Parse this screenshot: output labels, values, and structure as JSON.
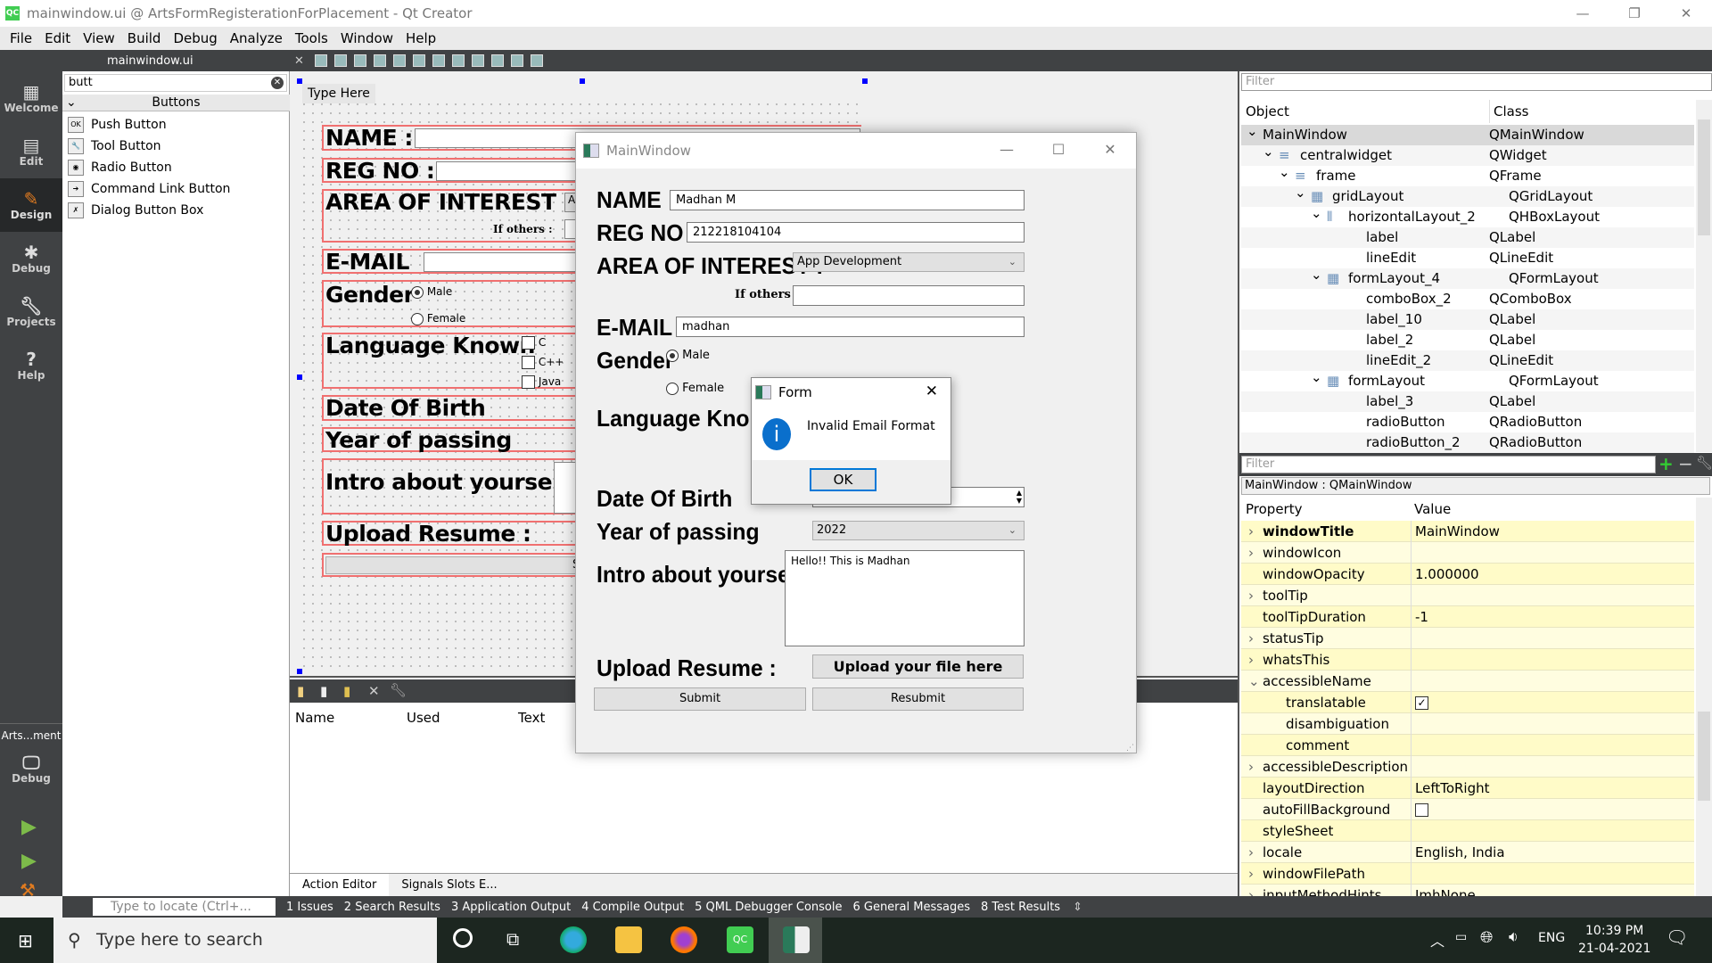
{
  "window": {
    "title": "mainwindow.ui @ ArtsFormRegisterationForPlacement - Qt Creator",
    "app_icon": "QC"
  },
  "menu": [
    "File",
    "Edit",
    "View",
    "Build",
    "Debug",
    "Analyze",
    "Tools",
    "Window",
    "Help"
  ],
  "toolbar": {
    "file": "mainwindow.ui"
  },
  "modes": [
    "Welcome",
    "Edit",
    "Design",
    "Debug",
    "Projects",
    "Help"
  ],
  "kit": {
    "project": "Arts...ment",
    "mode": "Debug"
  },
  "widgetbox": {
    "search": "butt",
    "category": "Buttons",
    "items": [
      {
        "label": "Push Button",
        "icon": "OK"
      },
      {
        "label": "Tool Button",
        "icon": "🔧"
      },
      {
        "label": "Radio Button",
        "icon": "◉"
      },
      {
        "label": "Command Link Button",
        "icon": "➔"
      },
      {
        "label": "Dialog Button Box",
        "icon": "✗"
      }
    ]
  },
  "designer": {
    "type_here": "Type Here",
    "labels": {
      "name": "NAME :",
      "reg": "REG NO :",
      "area": "AREA OF INTEREST :",
      "area_combo": "A",
      "others": "If others :",
      "email": "E-MAIL",
      "gender": "Gender",
      "male": "Male",
      "female": "Female",
      "lang": "Language Known",
      "c": "C",
      "cpp": "C++",
      "java": "Java",
      "dob": "Date Of Birth",
      "year": "Year of passing",
      "intro": "Intro about yourself",
      "upload": "Upload Resume :",
      "submit": "Submit"
    }
  },
  "action_editor": {
    "columns": [
      "Name",
      "Used",
      "Text"
    ],
    "tabs": [
      "Action Editor",
      "Signals  Slots E..."
    ]
  },
  "object_inspector": {
    "filter": "Filter",
    "headers": [
      "Object",
      "Class"
    ],
    "rows": [
      {
        "name": "MainWindow",
        "cls": "QMainWindow",
        "depth": 0,
        "exp": true
      },
      {
        "name": "centralwidget",
        "cls": "QWidget",
        "depth": 1,
        "exp": true,
        "icon": "≡"
      },
      {
        "name": "frame",
        "cls": "QFrame",
        "depth": 2,
        "exp": true,
        "icon": "≡"
      },
      {
        "name": "gridLayout",
        "cls": "QGridLayout",
        "depth": 3,
        "exp": true,
        "icon": "▦"
      },
      {
        "name": "horizontalLayout_2",
        "cls": "QHBoxLayout",
        "depth": 4,
        "exp": true,
        "icon": "⫴"
      },
      {
        "name": "label",
        "cls": "QLabel",
        "depth": 5
      },
      {
        "name": "lineEdit",
        "cls": "QLineEdit",
        "depth": 5
      },
      {
        "name": "formLayout_4",
        "cls": "QFormLayout",
        "depth": 4,
        "exp": true,
        "icon": "▦"
      },
      {
        "name": "comboBox_2",
        "cls": "QComboBox",
        "depth": 5
      },
      {
        "name": "label_10",
        "cls": "QLabel",
        "depth": 5
      },
      {
        "name": "label_2",
        "cls": "QLabel",
        "depth": 5
      },
      {
        "name": "lineEdit_2",
        "cls": "QLineEdit",
        "depth": 5
      },
      {
        "name": "formLayout",
        "cls": "QFormLayout",
        "depth": 4,
        "exp": true,
        "icon": "▦"
      },
      {
        "name": "label_3",
        "cls": "QLabel",
        "depth": 5
      },
      {
        "name": "radioButton",
        "cls": "QRadioButton",
        "depth": 5
      },
      {
        "name": "radioButton_2",
        "cls": "QRadioButton",
        "depth": 5
      }
    ]
  },
  "property_editor": {
    "filter": "Filter",
    "object": "MainWindow : QMainWindow",
    "headers": [
      "Property",
      "Value"
    ],
    "rows": [
      {
        "name": "windowTitle",
        "value": "MainWindow",
        "bold": true,
        "arrow": ">"
      },
      {
        "name": "windowIcon",
        "value": "",
        "arrow": ">"
      },
      {
        "name": "windowOpacity",
        "value": "1.000000"
      },
      {
        "name": "toolTip",
        "value": "",
        "arrow": ">"
      },
      {
        "name": "toolTipDuration",
        "value": "-1"
      },
      {
        "name": "statusTip",
        "value": "",
        "arrow": ">"
      },
      {
        "name": "whatsThis",
        "value": "",
        "arrow": ">"
      },
      {
        "name": "accessibleName",
        "value": "",
        "arrow": "v"
      },
      {
        "name": "translatable",
        "value": "",
        "sub": true,
        "check": true
      },
      {
        "name": "disambiguation",
        "value": "",
        "sub": true
      },
      {
        "name": "comment",
        "value": "",
        "sub": true
      },
      {
        "name": "accessibleDescription",
        "value": "",
        "arrow": ">"
      },
      {
        "name": "layoutDirection",
        "value": "LeftToRight"
      },
      {
        "name": "autoFillBackground",
        "value": "",
        "check": false
      },
      {
        "name": "styleSheet",
        "value": ""
      },
      {
        "name": "locale",
        "value": "English, India",
        "arrow": ">"
      },
      {
        "name": "windowFilePath",
        "value": "",
        "arrow": ">"
      },
      {
        "name": "inputMethodHints",
        "value": "ImhNone",
        "arrow": ">"
      }
    ]
  },
  "output_bar": {
    "locator": "Type to locate (Ctrl+...",
    "tabs": [
      "1  Issues",
      "2  Search Results",
      "3  Application Output",
      "4  Compile Output",
      "5  QML Debugger Console",
      "6  General Messages",
      "8  Test Results"
    ]
  },
  "mainwindow": {
    "title": "MainWindow",
    "name_label": "NAME :",
    "name": "Madhan M",
    "reg_label": "REG NO :",
    "reg": "212218104104",
    "area_label": "AREA OF INTEREST :",
    "area": "App Development",
    "others_label": "If others :",
    "others": "",
    "email_label": "E-MAIL",
    "email": "madhan",
    "gender_label": "Gender",
    "male": "Male",
    "female": "Female",
    "lang_label": "Language Kno",
    "dob_label": "Date Of Birth",
    "year_label": "Year of passing",
    "year": "2022",
    "intro_label": "Intro about yourself",
    "intro": "Hello!! This is Madhan",
    "upload_label": "Upload Resume :",
    "upload_btn": "Upload your file here",
    "submit": "Submit",
    "resubmit": "Resubmit"
  },
  "message_box": {
    "title": "Form",
    "text": "Invalid Email Format",
    "ok": "OK"
  },
  "taskbar": {
    "search": "Type here to search",
    "lang": "ENG",
    "time": "10:39 PM",
    "date": "21-04-2021"
  }
}
